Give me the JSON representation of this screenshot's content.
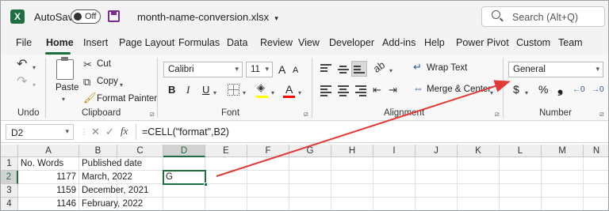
{
  "title_bar": {
    "autosave_label": "AutoSave",
    "autosave_state": "Off",
    "filename": "month-name-conversion.xlsx",
    "filename_chevron": "▾",
    "search_placeholder": "Search (Alt+Q)"
  },
  "tabs": [
    "File",
    "Home",
    "Insert",
    "Page Layout",
    "Formulas",
    "Data",
    "Review",
    "View",
    "Developer",
    "Add-ins",
    "Help",
    "Power Pivot",
    "Custom",
    "Team"
  ],
  "active_tab": "Home",
  "ribbon": {
    "undo": {
      "label": "Undo"
    },
    "clipboard": {
      "label": "Clipboard",
      "paste": "Paste",
      "cut": "Cut",
      "copy": "Copy",
      "format_painter": "Format Painter"
    },
    "font": {
      "label": "Font",
      "font_name": "Calibri",
      "font_size": "11",
      "grow": "A",
      "shrink": "A",
      "bold": "B",
      "italic": "I",
      "underline": "U",
      "font_color_glyph": "A"
    },
    "alignment": {
      "label": "Alignment",
      "wrap_text": "Wrap Text",
      "merge_center": "Merge & Center"
    },
    "number": {
      "label": "Number",
      "format": "General",
      "currency": "$",
      "percent": "%",
      "comma": "❟"
    },
    "colors": {
      "accent": "#1d6f42",
      "fill_bar": "#ffff00",
      "font_bar": "#ff0000",
      "arrow": "#e53935"
    }
  },
  "formula_bar": {
    "name_box": "D2",
    "cancel": "✕",
    "enter": "✓",
    "fx": "fx",
    "formula": "=CELL(\"format\",B2)"
  },
  "sheet": {
    "columns": [
      "A",
      "B",
      "C",
      "D",
      "E",
      "F",
      "G",
      "H",
      "I",
      "J",
      "K",
      "L",
      "M",
      "N"
    ],
    "row_numbers": [
      "1",
      "2",
      "3",
      "4"
    ],
    "rows": [
      {
        "a": "No. Words",
        "b": "Published date",
        "d": ""
      },
      {
        "a": "1177",
        "b": "March, 2022",
        "d": "G"
      },
      {
        "a": "1159",
        "b": "December, 2021",
        "d": ""
      },
      {
        "a": "1146",
        "b": "February, 2022",
        "d": ""
      }
    ],
    "active_cell": "D2"
  }
}
